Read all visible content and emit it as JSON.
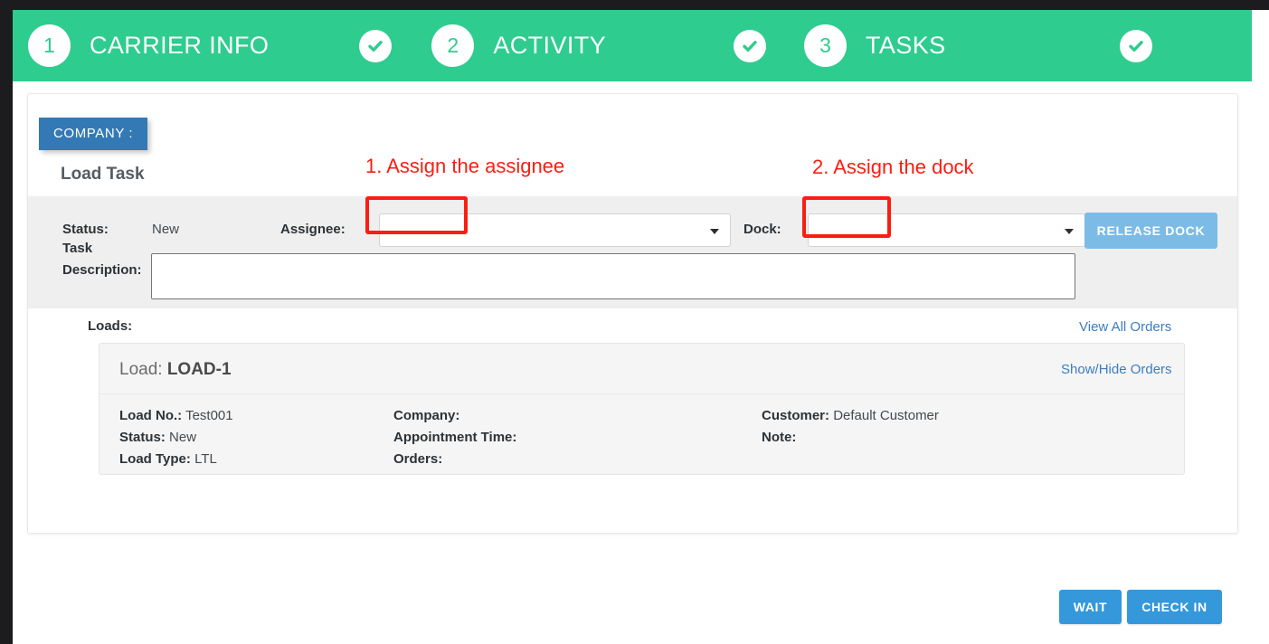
{
  "steps": [
    {
      "number": "1",
      "label": "CARRIER INFO",
      "check_icon": "check-circle-icon"
    },
    {
      "number": "2",
      "label": "ACTIVITY",
      "check_icon": "check-circle-icon"
    },
    {
      "number": "3",
      "label": "TASKS",
      "check_icon": "check-circle-icon"
    }
  ],
  "company_tab": {
    "label": "COMPANY :"
  },
  "section": {
    "title": "Load Task"
  },
  "form": {
    "status_label": "Status:",
    "status_value": "New",
    "assignee_label": "Assignee:",
    "assignee_value": "",
    "assignee_caret_icon": "chevron-down-icon",
    "dock_label": "Dock:",
    "dock_value": "",
    "dock_caret_icon": "chevron-down-icon",
    "release_dock_label": "RELEASE DOCK",
    "task_description_label_line1": "Task",
    "task_description_label_line2": "Description:",
    "task_description_value": ""
  },
  "annotations": [
    {
      "text": "1. Assign the assignee",
      "color": "#fc1d12"
    },
    {
      "text": "2. Assign the dock",
      "color": "#fc1d12"
    }
  ],
  "loads": {
    "label": "Loads:",
    "view_all_orders": "View All Orders",
    "card": {
      "title_prefix": "Load: ",
      "title_value": "LOAD-1",
      "show_hide_orders": "Show/Hide Orders",
      "columns": [
        [
          {
            "label": "Load No.:",
            "value": "Test001"
          },
          {
            "label": "Status:",
            "value": "New"
          },
          {
            "label": "Load Type:",
            "value": "LTL"
          }
        ],
        [
          {
            "label": "Company:",
            "value": ""
          },
          {
            "label": "Appointment Time:",
            "value": ""
          },
          {
            "label": "Orders:",
            "value": ""
          }
        ],
        [
          {
            "label": "Customer:",
            "value": "Default Customer"
          },
          {
            "label": "Note:",
            "value": ""
          }
        ]
      ]
    }
  },
  "footer": {
    "wait_label": "WAIT",
    "check_in_label": "CHECK IN"
  },
  "colors": {
    "header_green": "#2ecc8f",
    "tab_blue": "#3379b5",
    "button_blue": "#3498db",
    "button_blue_light": "#7cbbe6",
    "annotation_red": "#fc1d12",
    "link_blue": "#3c7dbf"
  }
}
